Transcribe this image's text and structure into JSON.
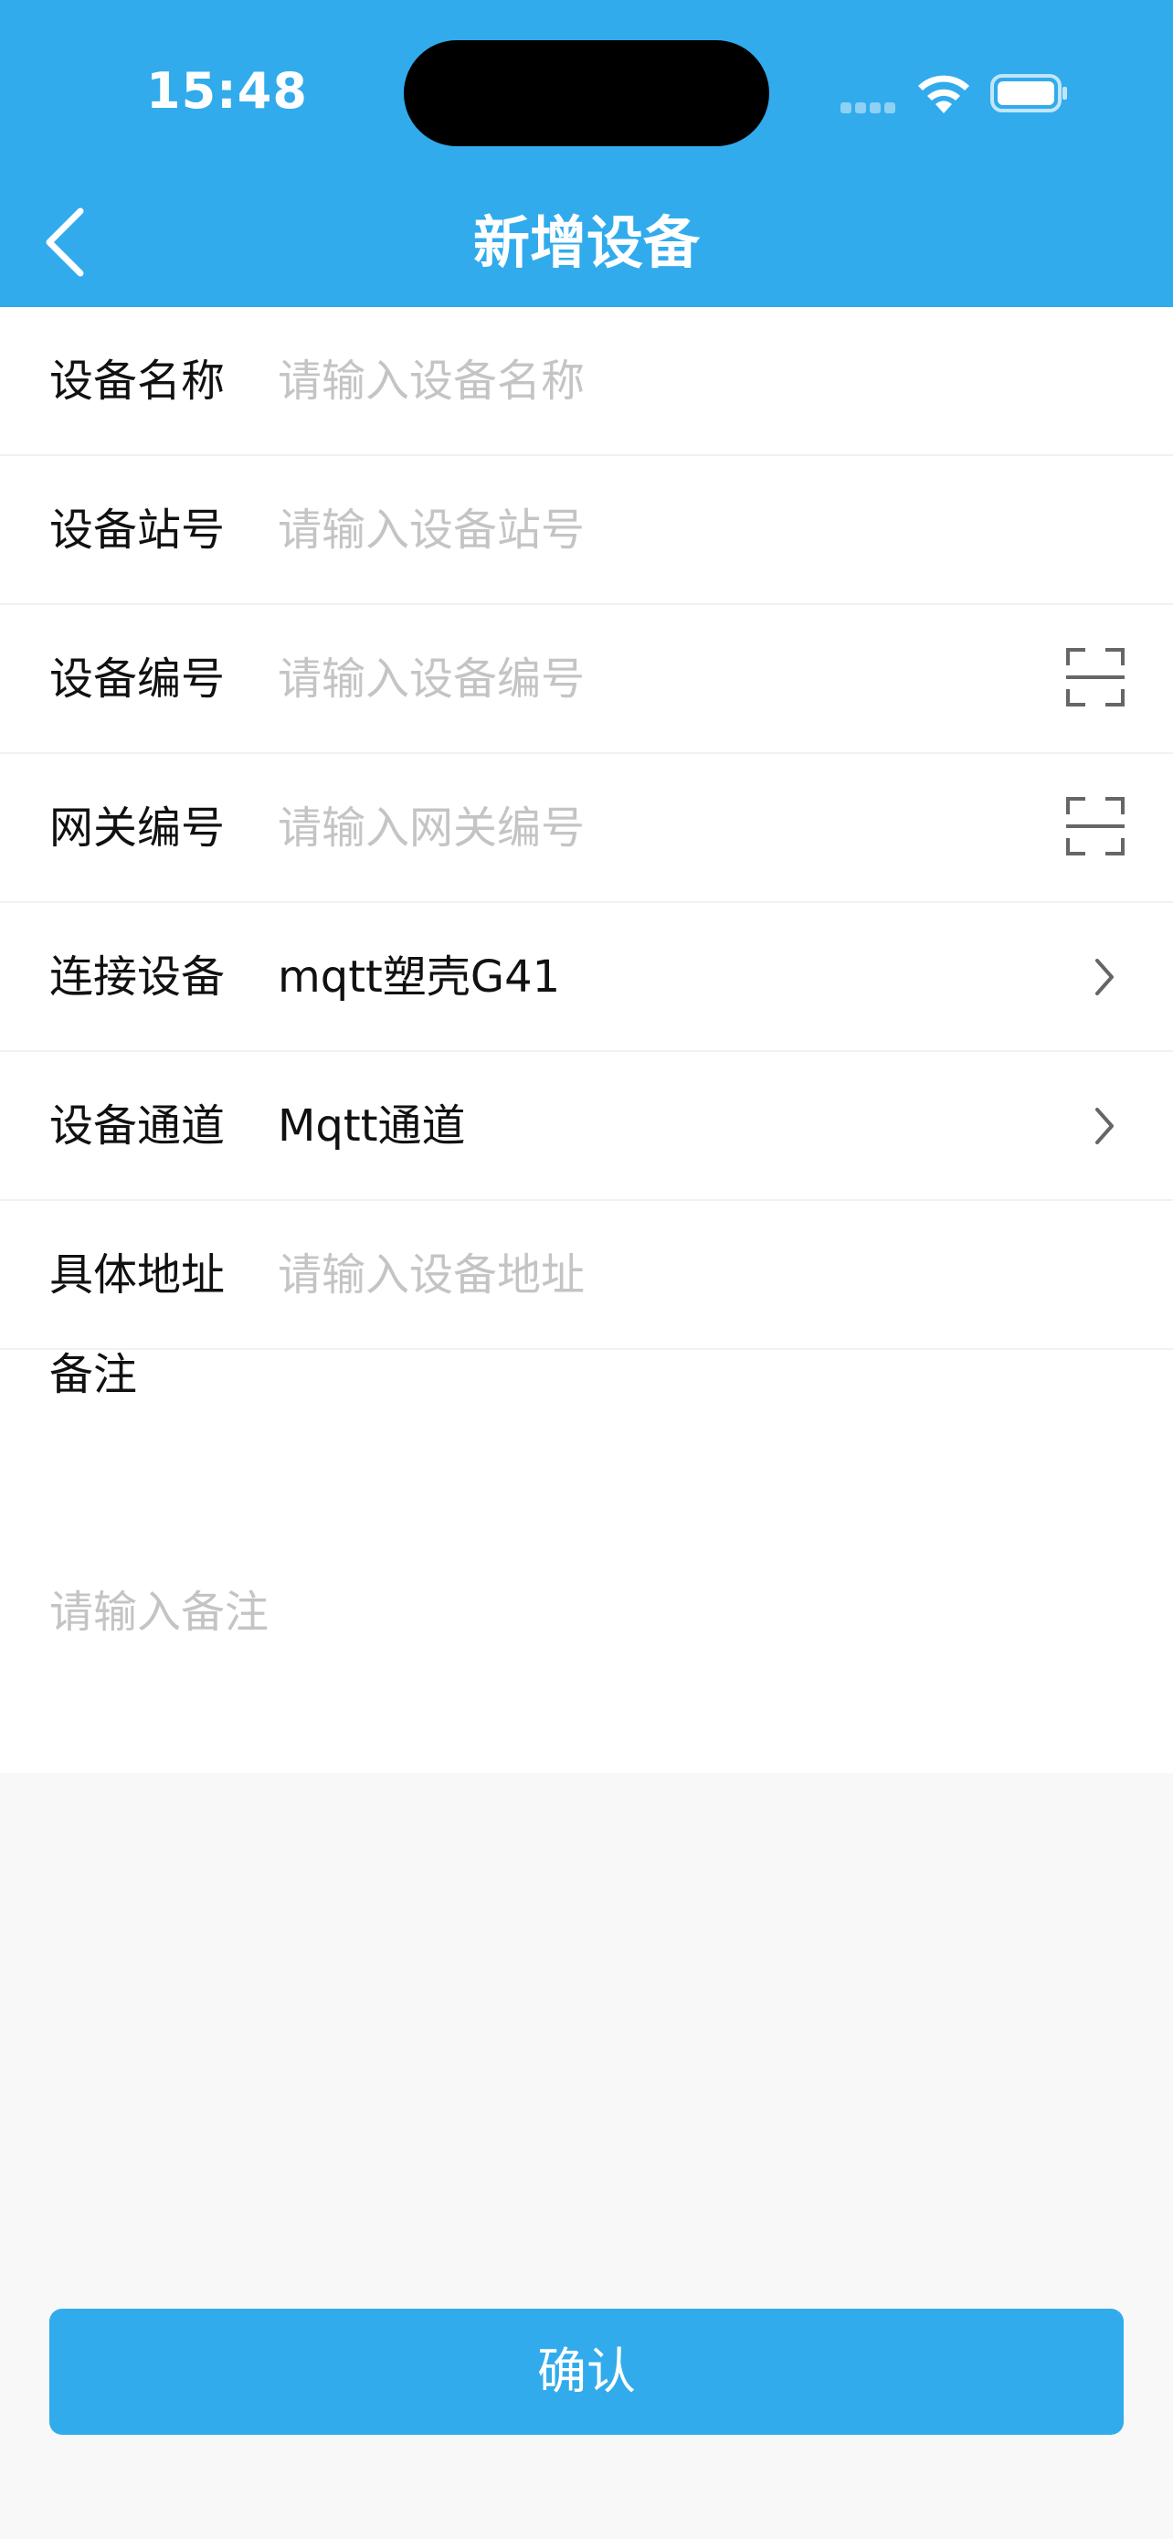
{
  "status_bar": {
    "time": "15:48"
  },
  "nav": {
    "title": "新增设备",
    "back_icon": "chevron-left-icon"
  },
  "form": {
    "rows": [
      {
        "label": "设备名称",
        "placeholder": "请输入设备名称",
        "value": "",
        "trailing": "none"
      },
      {
        "label": "设备站号",
        "placeholder": "请输入设备站号",
        "value": "",
        "trailing": "none"
      },
      {
        "label": "设备编号",
        "placeholder": "请输入设备编号",
        "value": "",
        "trailing": "scan-icon"
      },
      {
        "label": "网关编号",
        "placeholder": "请输入网关编号",
        "value": "",
        "trailing": "scan-icon"
      },
      {
        "label": "连接设备",
        "placeholder": "",
        "value": "mqtt塑壳G41",
        "trailing": "chevron-right-icon"
      },
      {
        "label": "设备通道",
        "placeholder": "",
        "value": "Mqtt通道",
        "trailing": "chevron-right-icon"
      },
      {
        "label": "具体地址",
        "placeholder": "请输入设备地址",
        "value": "",
        "trailing": "none"
      }
    ],
    "remark": {
      "label": "备注",
      "placeholder": "请输入备注"
    }
  },
  "confirm_label": "确认",
  "colors": {
    "primary": "#31abec",
    "placeholder": "#c4c4c4",
    "background": "#f8f8f8"
  }
}
